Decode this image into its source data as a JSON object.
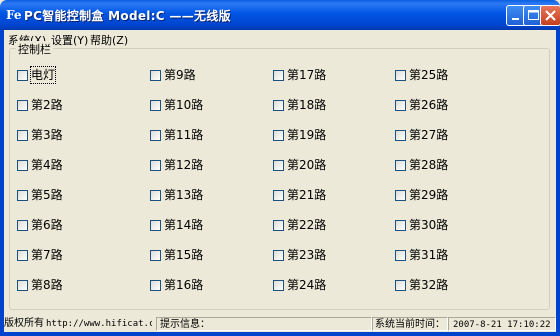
{
  "window": {
    "title": "PC智能控制盒 Model:C ——无线版",
    "icon": "app-icon",
    "icon_glyph": "Fe"
  },
  "menu": [
    {
      "label": "系统(X)"
    },
    {
      "label": "设置(Y)"
    },
    {
      "label": "帮助(Z)"
    }
  ],
  "group": {
    "label": "控制栏"
  },
  "checkboxes": [
    {
      "label": "电灯",
      "checked": false
    },
    {
      "label": "第2路",
      "checked": false
    },
    {
      "label": "第3路",
      "checked": false
    },
    {
      "label": "第4路",
      "checked": false
    },
    {
      "label": "第5路",
      "checked": false
    },
    {
      "label": "第6路",
      "checked": false
    },
    {
      "label": "第7路",
      "checked": false
    },
    {
      "label": "第8路",
      "checked": false
    },
    {
      "label": "第9路",
      "checked": false
    },
    {
      "label": "第10路",
      "checked": false
    },
    {
      "label": "第11路",
      "checked": false
    },
    {
      "label": "第12路",
      "checked": false
    },
    {
      "label": "第13路",
      "checked": false
    },
    {
      "label": "第14路",
      "checked": false
    },
    {
      "label": "第15路",
      "checked": false
    },
    {
      "label": "第16路",
      "checked": false
    },
    {
      "label": "第17路",
      "checked": false
    },
    {
      "label": "第18路",
      "checked": false
    },
    {
      "label": "第19路",
      "checked": false
    },
    {
      "label": "第20路",
      "checked": false
    },
    {
      "label": "第21路",
      "checked": false
    },
    {
      "label": "第22路",
      "checked": false
    },
    {
      "label": "第23路",
      "checked": false
    },
    {
      "label": "第24路",
      "checked": false
    },
    {
      "label": "第25路",
      "checked": false
    },
    {
      "label": "第26路",
      "checked": false
    },
    {
      "label": "第27路",
      "checked": false
    },
    {
      "label": "第28路",
      "checked": false
    },
    {
      "label": "第29路",
      "checked": false
    },
    {
      "label": "第30路",
      "checked": false
    },
    {
      "label": "第31路",
      "checked": false
    },
    {
      "label": "第32路",
      "checked": false
    }
  ],
  "status": {
    "copyright": "版权所有",
    "url": "http://www.hificat.com",
    "hint_label": "提示信息：",
    "hint_value": "",
    "time_label": "系统当前时间：",
    "time_value": "2007-8-21 17:10:22"
  },
  "colors": {
    "titlebar": "#0054E3",
    "window_bg": "#ECE9D8",
    "close_button": "#D8482A"
  }
}
